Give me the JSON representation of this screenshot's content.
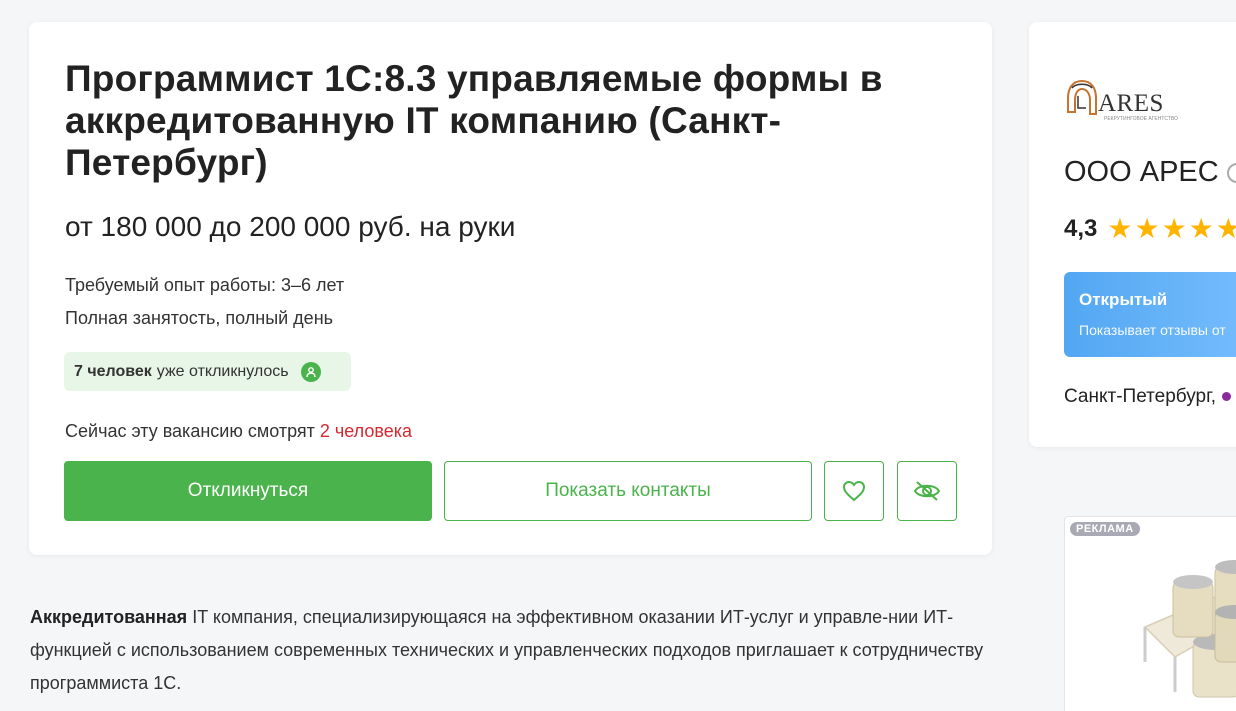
{
  "vacancy": {
    "title": "Программист 1С:8.3 управляемые формы в аккредитованную IT компанию (Санкт-Петербург)",
    "salary": "от 180 000 до 200 000 руб. на руки",
    "experience": "Требуемый опыт работы: 3–6 лет",
    "employment": "Полная занятость, полный день",
    "responses_count": "7 человек",
    "responses_text": "уже откликнулось",
    "viewing_text": "Сейчас эту вакансию смотрят",
    "viewing_count": "2 человека",
    "respond_button": "Откликнуться",
    "contacts_button": "Показать контакты",
    "description_bold": "Аккредитованная",
    "description_rest": " IT компания, специализирующаяся на эффективном оказании ИТ-услуг и управле-нии ИТ-функцией с использованием современных технических и управленческих подходов приглашает к сотрудничеству программиста 1С."
  },
  "employer": {
    "logo_text": "ARES",
    "logo_subtext": "РЕКРУТИНГОВОЕ АГЕНТСТВО",
    "name": "ООО АРЕС",
    "rating": "4,3",
    "stars": "★★★★★",
    "open_title": "Открытый",
    "open_subtitle": "Показывает отзывы от",
    "city": "Санкт-Петербург,"
  },
  "ad": {
    "label": "РЕКЛАМА"
  },
  "colors": {
    "primary_green": "#4bb34b",
    "highlight_red": "#d6282f",
    "star_yellow": "#ffb400",
    "open_blue": "#52a7f2"
  }
}
